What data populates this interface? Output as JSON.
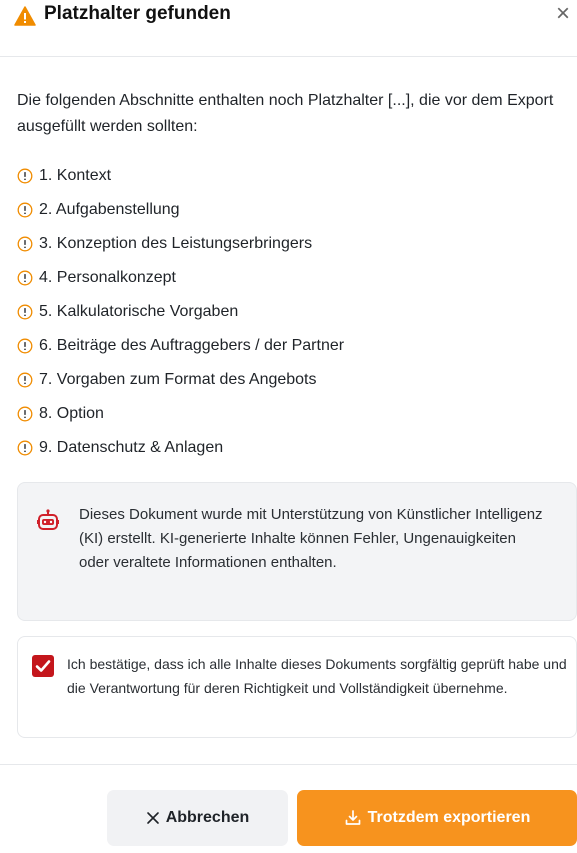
{
  "dialog": {
    "title": "Platzhalter gefunden",
    "close_symbol": "×"
  },
  "message": "Die folgenden Abschnitte enthalten noch Platzhalter [...], die vor dem Export ausgefüllt werden sollten:",
  "sections": [
    "1. Kontext",
    "2. Aufgabenstellung",
    "3. Konzeption des Leistungserbringers",
    "4. Personalkonzept",
    "5. Kalkulatorische Vorgaben",
    "6. Beiträge des Auftraggebers / der Partner",
    "7. Vorgaben zum Format des Angebots",
    "8. Option",
    "9. Datenschutz & Anlagen"
  ],
  "ai_notice": "Dieses Dokument wurde mit Unterstützung von Künstlicher Intelligenz (KI) erstellt. KI-generierte Inhalte können Fehler, Ungenauigkeiten oder veraltete Informationen enthalten.",
  "confirmation": {
    "checked": true,
    "text": "Ich bestätige, dass ich alle Inhalte dieses Dokuments sorgfältig geprüft habe und die Verantwortung für deren Richtigkeit und Vollständigkeit übernehme."
  },
  "buttons": {
    "cancel": "Abbrechen",
    "export": "Trotzdem exportieren"
  },
  "icons": {
    "warning": "warning-triangle-icon",
    "item": "exclamation-circle-icon",
    "ai": "robot-icon",
    "check": "checkmark-icon",
    "cancel": "x-icon",
    "export": "download-icon"
  },
  "colors": {
    "warning": "#f08c00",
    "accent": "#f7931e",
    "checkbox": "#c4161c",
    "robot": "#d0202a"
  }
}
